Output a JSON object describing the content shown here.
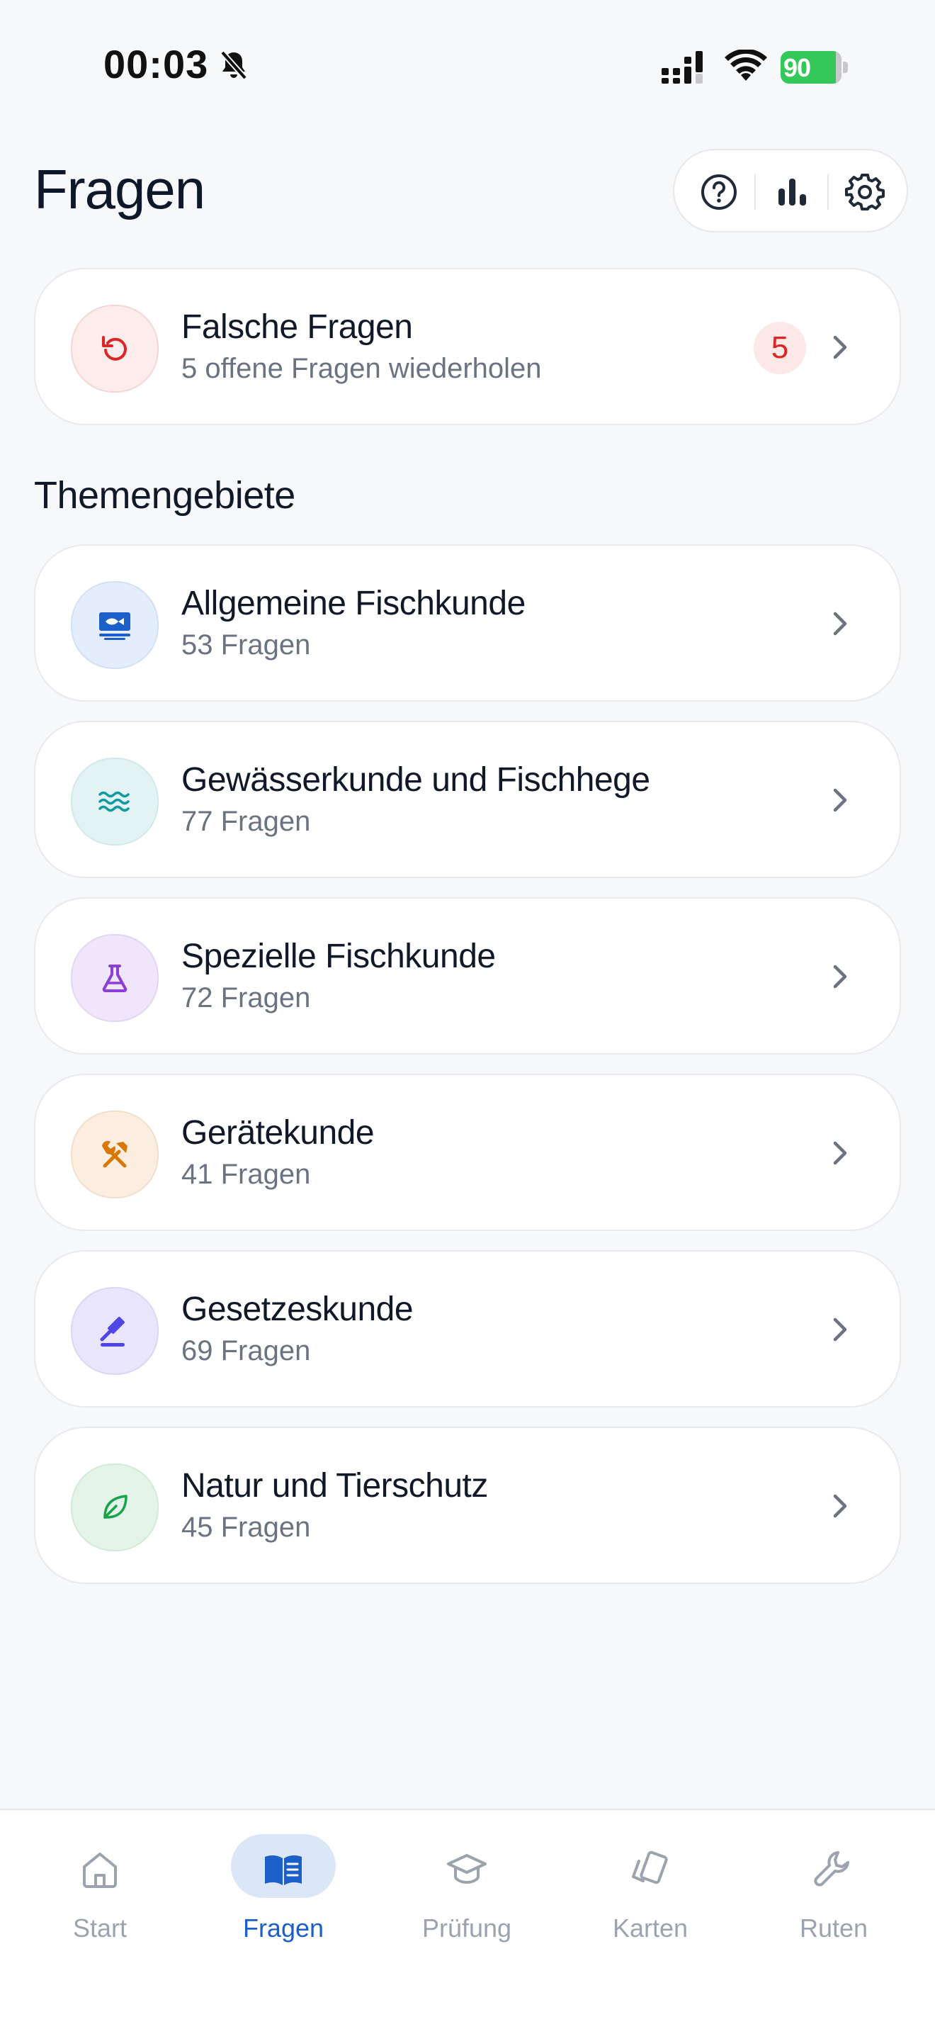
{
  "status_bar": {
    "time": "00:03",
    "battery": "90"
  },
  "header": {
    "title": "Fragen"
  },
  "wrong_questions": {
    "title": "Falsche Fragen",
    "subtitle": "5 offene Fragen wiederholen",
    "count": "5"
  },
  "section": {
    "title": "Themengebiete"
  },
  "topics": [
    {
      "title": "Allgemeine Fischkunde",
      "subtitle": "53 Fragen"
    },
    {
      "title": "Gewässerkunde und Fischhege",
      "subtitle": "77 Fragen"
    },
    {
      "title": "Spezielle Fischkunde",
      "subtitle": "72 Fragen"
    },
    {
      "title": "Gerätekunde",
      "subtitle": "41 Fragen"
    },
    {
      "title": "Gesetzeskunde",
      "subtitle": "69 Fragen"
    },
    {
      "title": "Natur und Tierschutz",
      "subtitle": "45 Fragen"
    }
  ],
  "tabs": [
    {
      "label": "Start"
    },
    {
      "label": "Fragen"
    },
    {
      "label": "Prüfung"
    },
    {
      "label": "Karten"
    },
    {
      "label": "Ruten"
    }
  ],
  "colors": {
    "accent": "#1d5fc9",
    "danger": "#dc2626",
    "inactive": "#9ca3af"
  }
}
